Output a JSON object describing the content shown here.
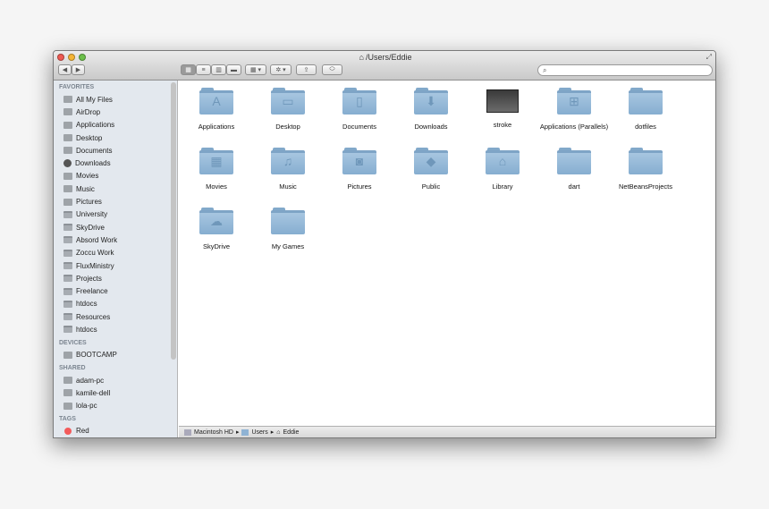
{
  "window": {
    "title": "/Users/Eddie",
    "search_placeholder": ""
  },
  "toolbar": {
    "back": "◀",
    "forward": "▶",
    "view_icon": "▦",
    "view_list": "≡",
    "view_columns": "▥",
    "view_coverflow": "▬",
    "arrange": "▦ ▾",
    "action": "✲ ▾",
    "share": "⇪",
    "tags": "⬭"
  },
  "sidebar": {
    "sections": [
      {
        "title": "FAVORITES",
        "items": [
          {
            "label": "All My Files",
            "icon": "all-files"
          },
          {
            "label": "AirDrop",
            "icon": "airdrop"
          },
          {
            "label": "Applications",
            "icon": "applications"
          },
          {
            "label": "Desktop",
            "icon": "desktop"
          },
          {
            "label": "Documents",
            "icon": "documents"
          },
          {
            "label": "Downloads",
            "icon": "downloads"
          },
          {
            "label": "Movies",
            "icon": "movies"
          },
          {
            "label": "Music",
            "icon": "music"
          },
          {
            "label": "Pictures",
            "icon": "pictures"
          },
          {
            "label": "University",
            "icon": "folder"
          },
          {
            "label": "SkyDrive",
            "icon": "folder"
          },
          {
            "label": "Absord Work",
            "icon": "folder"
          },
          {
            "label": "Zoccu Work",
            "icon": "folder"
          },
          {
            "label": "FluxMinistry",
            "icon": "folder"
          },
          {
            "label": "Projects",
            "icon": "folder"
          },
          {
            "label": "Freelance",
            "icon": "folder"
          },
          {
            "label": "htdocs",
            "icon": "folder"
          },
          {
            "label": "Resources",
            "icon": "folder"
          },
          {
            "label": "htdocs",
            "icon": "folder"
          }
        ]
      },
      {
        "title": "DEVICES",
        "items": [
          {
            "label": "BOOTCAMP",
            "icon": "disk"
          }
        ]
      },
      {
        "title": "SHARED",
        "items": [
          {
            "label": "adam-pc",
            "icon": "pc"
          },
          {
            "label": "kamile-dell",
            "icon": "pc"
          },
          {
            "label": "lola-pc",
            "icon": "pc"
          }
        ]
      },
      {
        "title": "TAGS",
        "items": [
          {
            "label": "Red",
            "icon": "tag",
            "color": "#f35b5b"
          }
        ]
      }
    ]
  },
  "files": [
    {
      "label": "Applications",
      "glyph": "A"
    },
    {
      "label": "Desktop",
      "glyph": "▭"
    },
    {
      "label": "Documents",
      "glyph": "▯"
    },
    {
      "label": "Downloads",
      "glyph": "⬇"
    },
    {
      "label": "stroke",
      "type": "image"
    },
    {
      "label": "Applications (Parallels)",
      "glyph": "⊞"
    },
    {
      "label": "dotfiles",
      "glyph": ""
    },
    {
      "label": "Movies",
      "glyph": "▦"
    },
    {
      "label": "Music",
      "glyph": "♫"
    },
    {
      "label": "Pictures",
      "glyph": "◙"
    },
    {
      "label": "Public",
      "glyph": "◆"
    },
    {
      "label": "Library",
      "glyph": "⌂"
    },
    {
      "label": "dart",
      "glyph": ""
    },
    {
      "label": "NetBeansProjects",
      "glyph": ""
    },
    {
      "label": "SkyDrive",
      "glyph": "☁"
    },
    {
      "label": "My Games",
      "glyph": ""
    }
  ],
  "pathbar": [
    "Macintosh HD",
    "Users",
    "Eddie"
  ]
}
